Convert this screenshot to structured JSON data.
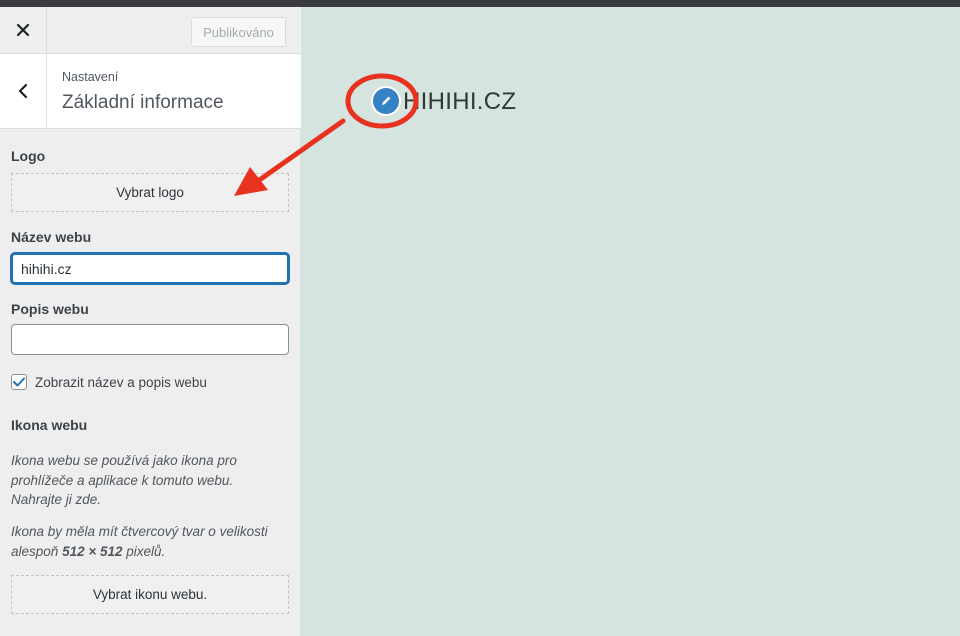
{
  "header": {
    "close_icon": "close-icon",
    "publish_label": "Publikováno"
  },
  "section": {
    "breadcrumb": "Nastavení",
    "title": "Základní informace",
    "back_icon": "chevron-left-icon"
  },
  "logo": {
    "label": "Logo",
    "button_label": "Vybrat logo"
  },
  "site_title": {
    "label": "Název webu",
    "value": "hihihi.cz"
  },
  "tagline": {
    "label": "Popis webu",
    "value": ""
  },
  "display_option": {
    "label": "Zobrazit název a popis webu",
    "checked": true
  },
  "site_icon": {
    "label": "Ikona webu",
    "desc1": "Ikona webu se používá jako ikona pro prohlížeče a aplikace k tomuto webu. Nahrajte ji zde.",
    "desc2_prefix": "Ikona by měla mít čtvercový tvar o velikosti alespoň",
    "desc2_size": "512 × 512",
    "desc2_suffix": "pixelů.",
    "button_label": "Vybrat ikonu webu."
  },
  "preview": {
    "site_logo_text": "HIHIHI.CZ",
    "edit_icon": "pencil-icon"
  },
  "colors": {
    "accent": "#2271b1",
    "annotation": "#e8321f",
    "preview_bg": "#d5e4de"
  }
}
